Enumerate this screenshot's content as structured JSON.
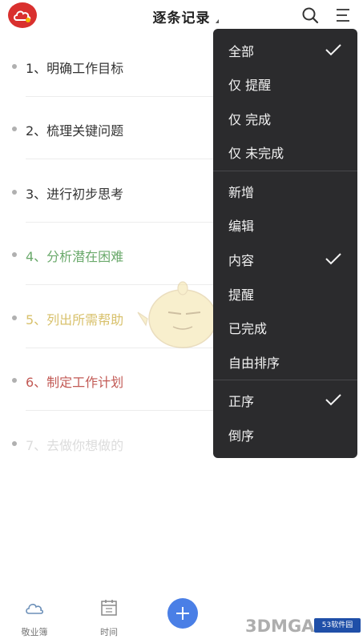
{
  "header": {
    "title": "逐条记录",
    "icons": [
      "app-logo",
      "search-icon",
      "menu-icon"
    ]
  },
  "list": [
    {
      "text": "1、明确工作目标",
      "color": "#333333"
    },
    {
      "text": "2、梳理关键问题",
      "color": "#333333"
    },
    {
      "text": "3、进行初步思考",
      "color": "#333333"
    },
    {
      "text": "4、分析潜在困难",
      "color": "#6aa96b"
    },
    {
      "text": "5、列出所需帮助",
      "color": "#d8c16c"
    },
    {
      "text": "6、制定工作计划",
      "color": "#c25a55"
    },
    {
      "text": "7、去做你想做的",
      "color": "#dcdcdc"
    }
  ],
  "dropdown": {
    "items": [
      {
        "label": "全部",
        "checked": true
      },
      {
        "label": "仅 提醒",
        "checked": false
      },
      {
        "label": "仅 完成",
        "checked": false
      },
      {
        "label": "仅 未完成",
        "checked": false
      },
      {
        "label": "新增",
        "checked": false
      },
      {
        "label": "编辑",
        "checked": false
      },
      {
        "label": "内容",
        "checked": true
      },
      {
        "label": "提醒",
        "checked": false
      },
      {
        "label": "已完成",
        "checked": false
      },
      {
        "label": "自由排序",
        "checked": false
      },
      {
        "label": "正序",
        "checked": true
      },
      {
        "label": "倒序",
        "checked": false
      }
    ]
  },
  "bottom_nav": {
    "items": [
      {
        "label": "敬业簿",
        "icon": "cloud-icon"
      },
      {
        "label": "时间",
        "icon": "calendar-icon"
      }
    ],
    "add_icon": "plus-icon"
  },
  "watermarks": {
    "left": "3DMGAME",
    "right": "53软件园"
  },
  "colors": {
    "accent": "#4a7fe6",
    "menu_bg": "#2b2b2d",
    "brand": "#d9302e"
  }
}
